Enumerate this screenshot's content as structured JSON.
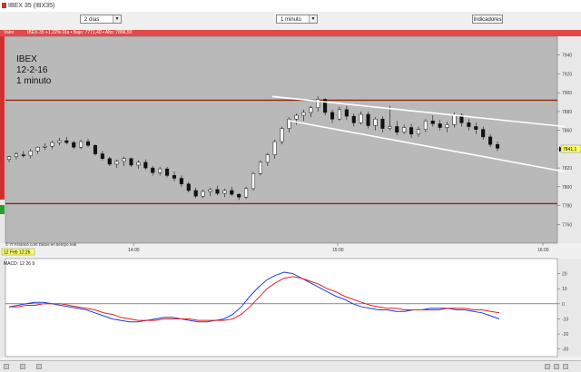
{
  "window": {
    "title": "IBEX 35 (IBX35)"
  },
  "toolbar": {
    "period": "2 días",
    "interval": "1 minuto",
    "indicators_label": "Indicadores"
  },
  "status": {
    "left": "Valor",
    "quote": "IBEX-35 +1,22% Día • Bajo: 7771,40 • Alto: 7896,50"
  },
  "annotation": {
    "line1": "IBEX",
    "line2": "12-2-16",
    "line3": "1 minuto"
  },
  "footer_credit": "© IT Finance.com Datos en tiempo real",
  "date_badge": "12 Feb 12:26",
  "price_badge": "7841,1",
  "macd_label": "MACD: 12 26 9",
  "chart_data": [
    {
      "type": "candlestick",
      "x_ticks": [
        "14:00",
        "15:00",
        "16:00"
      ],
      "ylim": [
        7740,
        7960
      ],
      "y_ticks": [
        7760,
        7780,
        7800,
        7820,
        7840,
        7860,
        7880,
        7900,
        7920,
        7940
      ],
      "levels": [
        7892,
        7782
      ],
      "channel": {
        "upper": [
          7896,
          7864
        ],
        "lower": [
          7870,
          7816
        ]
      },
      "candles": [
        [
          7829,
          7833,
          7826,
          7832
        ],
        [
          7832,
          7837,
          7829,
          7835
        ],
        [
          7834,
          7838,
          7831,
          7833
        ],
        [
          7833,
          7840,
          7830,
          7838
        ],
        [
          7838,
          7843,
          7835,
          7842
        ],
        [
          7842,
          7846,
          7839,
          7843
        ],
        [
          7843,
          7849,
          7840,
          7847
        ],
        [
          7847,
          7852,
          7844,
          7849
        ],
        [
          7849,
          7853,
          7845,
          7847
        ],
        [
          7847,
          7849,
          7840,
          7842
        ],
        [
          7842,
          7850,
          7840,
          7848
        ],
        [
          7848,
          7851,
          7842,
          7844
        ],
        [
          7844,
          7845,
          7833,
          7835
        ],
        [
          7835,
          7838,
          7828,
          7830
        ],
        [
          7830,
          7832,
          7822,
          7824
        ],
        [
          7824,
          7829,
          7820,
          7827
        ],
        [
          7827,
          7832,
          7822,
          7830
        ],
        [
          7830,
          7831,
          7821,
          7823
        ],
        [
          7823,
          7828,
          7819,
          7826
        ],
        [
          7826,
          7829,
          7818,
          7820
        ],
        [
          7820,
          7822,
          7812,
          7815
        ],
        [
          7815,
          7821,
          7812,
          7819
        ],
        [
          7819,
          7821,
          7810,
          7812
        ],
        [
          7812,
          7816,
          7806,
          7809
        ],
        [
          7809,
          7812,
          7800,
          7803
        ],
        [
          7803,
          7805,
          7794,
          7796
        ],
        [
          7796,
          7799,
          7788,
          7790
        ],
        [
          7790,
          7797,
          7788,
          7795
        ],
        [
          7795,
          7799,
          7790,
          7797
        ],
        [
          7797,
          7801,
          7791,
          7793
        ],
        [
          7793,
          7798,
          7789,
          7796
        ],
        [
          7796,
          7800,
          7790,
          7792
        ],
        [
          7792,
          7793,
          7786,
          7789
        ],
        [
          7789,
          7800,
          7787,
          7798
        ],
        [
          7798,
          7816,
          7796,
          7814
        ],
        [
          7814,
          7828,
          7812,
          7826
        ],
        [
          7826,
          7836,
          7822,
          7834
        ],
        [
          7834,
          7850,
          7830,
          7848
        ],
        [
          7848,
          7864,
          7845,
          7862
        ],
        [
          7862,
          7874,
          7858,
          7872
        ],
        [
          7872,
          7878,
          7866,
          7876
        ],
        [
          7876,
          7882,
          7870,
          7879
        ],
        [
          7879,
          7886,
          7874,
          7884
        ],
        [
          7884,
          7896,
          7880,
          7893
        ],
        [
          7893,
          7894,
          7876,
          7879
        ],
        [
          7879,
          7882,
          7868,
          7872
        ],
        [
          7872,
          7885,
          7870,
          7882
        ],
        [
          7882,
          7886,
          7871,
          7875
        ],
        [
          7875,
          7878,
          7864,
          7868
        ],
        [
          7868,
          7880,
          7866,
          7877
        ],
        [
          7877,
          7880,
          7862,
          7865
        ],
        [
          7865,
          7874,
          7860,
          7872
        ],
        [
          7872,
          7875,
          7858,
          7862
        ],
        [
          7862,
          7886,
          7860,
          7864
        ],
        [
          7864,
          7870,
          7855,
          7858
        ],
        [
          7858,
          7866,
          7856,
          7863
        ],
        [
          7863,
          7867,
          7852,
          7856
        ],
        [
          7856,
          7864,
          7853,
          7861
        ],
        [
          7861,
          7872,
          7858,
          7870
        ],
        [
          7870,
          7876,
          7864,
          7867
        ],
        [
          7867,
          7871,
          7860,
          7863
        ],
        [
          7863,
          7869,
          7858,
          7866
        ],
        [
          7866,
          7879,
          7863,
          7876
        ],
        [
          7876,
          7878,
          7864,
          7868
        ],
        [
          7868,
          7872,
          7860,
          7864
        ],
        [
          7864,
          7868,
          7856,
          7861
        ],
        [
          7861,
          7864,
          7850,
          7853
        ],
        [
          7853,
          7856,
          7842,
          7845
        ],
        [
          7845,
          7848,
          7838,
          7841
        ]
      ]
    },
    {
      "type": "line",
      "title": "MACD: 12 26 9",
      "ylim": [
        -35,
        30
      ],
      "y_ticks": [
        20,
        10,
        0,
        -10,
        -20,
        -30
      ],
      "series": [
        {
          "color": "#1e3cdc",
          "values": [
            -2,
            -1,
            0,
            1,
            1,
            0,
            -1,
            -2,
            -3,
            -4,
            -6,
            -8,
            -10,
            -11,
            -12,
            -12,
            -11,
            -10,
            -9,
            -9,
            -10,
            -11,
            -12,
            -12,
            -11,
            -10,
            -7,
            -2,
            5,
            11,
            16,
            19,
            21,
            20,
            17,
            14,
            11,
            8,
            5,
            3,
            0,
            -2,
            -3,
            -4,
            -4,
            -5,
            -5,
            -4,
            -4,
            -3,
            -3,
            -3,
            -4,
            -4,
            -5,
            -6,
            -8,
            -10
          ]
        },
        {
          "color": "#e02020",
          "values": [
            -2,
            -2,
            -1,
            -1,
            0,
            0,
            0,
            -1,
            -2,
            -3,
            -4,
            -6,
            -7,
            -9,
            -10,
            -11,
            -11,
            -11,
            -10,
            -10,
            -10,
            -10,
            -11,
            -11,
            -11,
            -11,
            -10,
            -7,
            -2,
            4,
            10,
            14,
            17,
            18,
            17,
            15,
            13,
            10,
            8,
            5,
            3,
            1,
            -1,
            -2,
            -3,
            -3,
            -4,
            -4,
            -4,
            -4,
            -4,
            -3,
            -3,
            -3,
            -4,
            -4,
            -5,
            -6
          ]
        }
      ]
    }
  ]
}
